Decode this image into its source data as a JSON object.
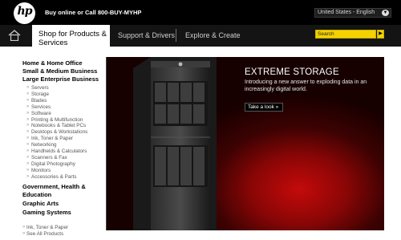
{
  "header": {
    "logo_text": "hp",
    "buy_online": "Buy online or Call 800-BUY-MYHP",
    "region": "United States - English"
  },
  "nav": {
    "shop_tab": "Shop for Products & Services",
    "support": "Support & Drivers",
    "explore": "Explore & Create",
    "search_placeholder": "Search"
  },
  "left_menu": {
    "categories_top": [
      "Home & Home Office",
      "Small & Medium Business",
      "Large Enterprise Business"
    ],
    "enterprise_items": [
      "Servers",
      "Storage",
      "Blades",
      "Services",
      "Software",
      "Printing & Multifunction",
      "Notebooks & Tablet PCs",
      "Desktops & Workstations",
      "Ink, Toner & Paper",
      "Networking",
      "Handhelds & Calculators",
      "Scanners & Fax",
      "Digital Photography",
      "Monitors",
      "Accessories & Parts"
    ],
    "categories_bottom": [
      "Government, Health & Education",
      "Graphic Arts",
      "Gaming Systems"
    ],
    "footer_links": [
      "Ink, Toner & Paper",
      "See All Products"
    ]
  },
  "hero": {
    "title": "EXTREME STORAGE",
    "text": "Introducing a new answer to exploding data in an increasingly digital world.",
    "cta": "Take a look »"
  },
  "colors": {
    "accent_yellow": "#f4d200",
    "hero_red": "#c40a0a",
    "nav_bg": "#141414"
  }
}
